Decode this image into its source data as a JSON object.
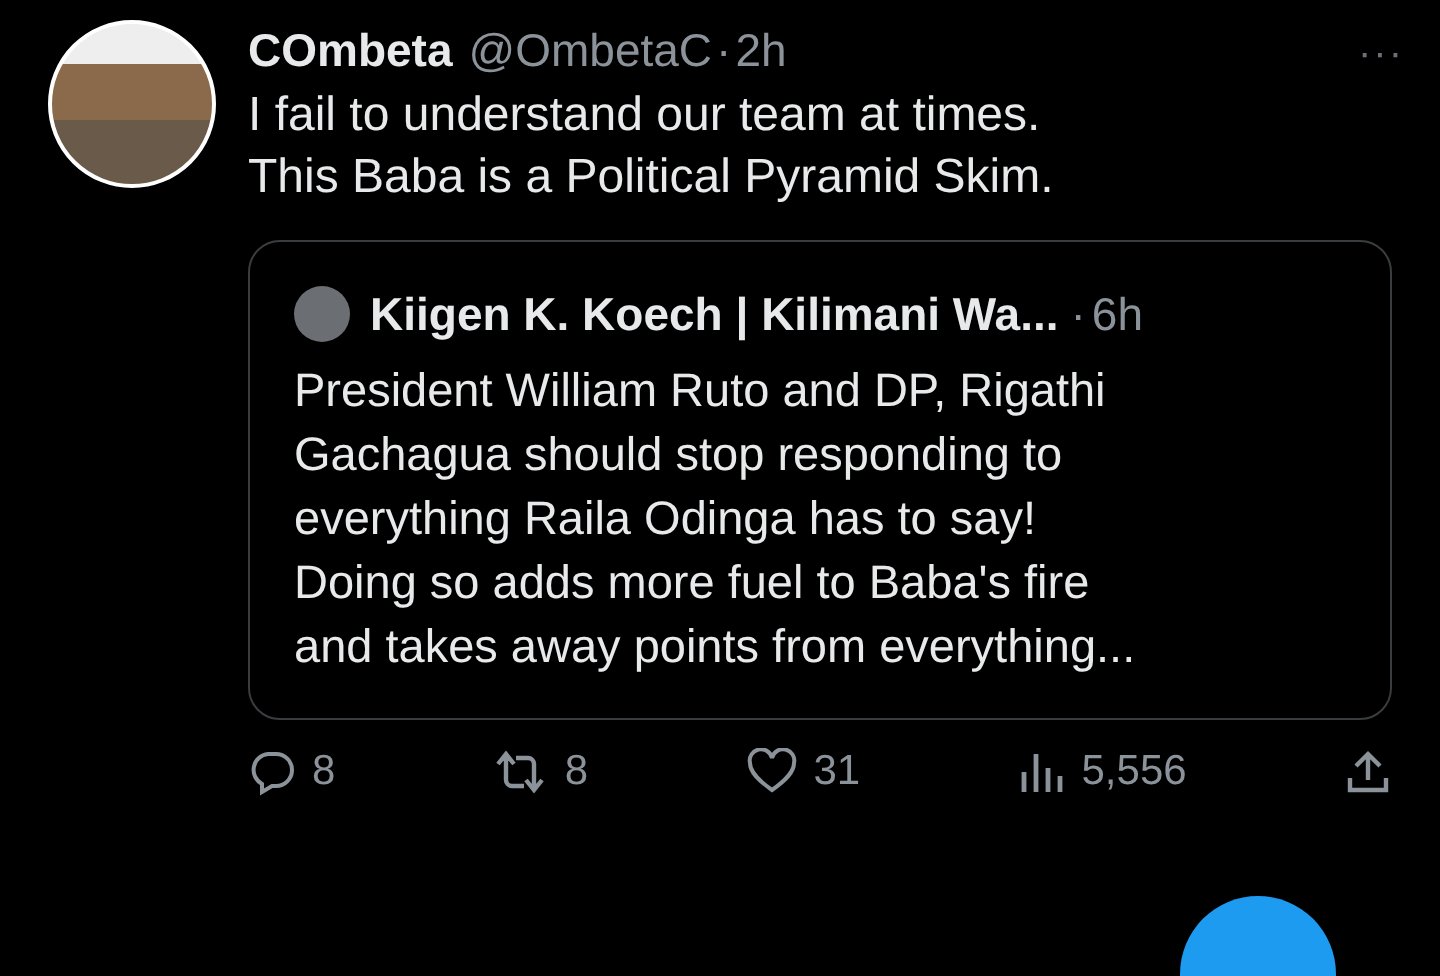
{
  "tweet": {
    "display_name": "COmbeta",
    "handle": "@OmbetaC",
    "separator": "·",
    "time": "2h",
    "more": "···",
    "text_lines": [
      "I fail to understand our team at times.",
      "This Baba is a Political Pyramid Skim."
    ]
  },
  "quoted_tweet": {
    "author": "Kiigen K. Koech | Kilimani Wa...",
    "separator": "·",
    "time": "6h",
    "text_lines": [
      "President William Ruto and DP, Rigathi",
      "Gachagua should stop responding to",
      "everything Raila Odinga has to say!",
      "Doing so adds more fuel to Baba's fire",
      "and takes away points from everything..."
    ]
  },
  "actions": [
    {
      "kind": "reply",
      "count": "8"
    },
    {
      "kind": "retweet",
      "count": "8"
    },
    {
      "kind": "like",
      "count": "31"
    },
    {
      "kind": "views",
      "count": "5,556"
    },
    {
      "kind": "share"
    }
  ]
}
